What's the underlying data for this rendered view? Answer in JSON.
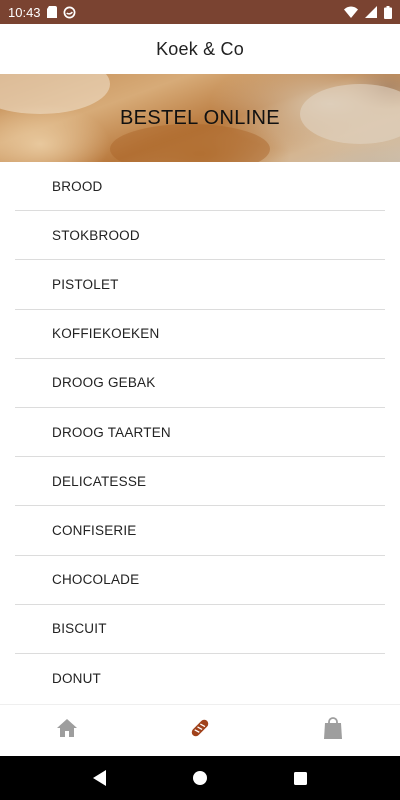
{
  "status_bar": {
    "time": "10:43"
  },
  "app_bar": {
    "title": "Koek & Co"
  },
  "banner": {
    "title": "BESTEL ONLINE"
  },
  "categories": [
    {
      "label": "BROOD"
    },
    {
      "label": "STOKBROOD"
    },
    {
      "label": "PISTOLET"
    },
    {
      "label": "KOFFIEKOEKEN"
    },
    {
      "label": "DROOG GEBAK"
    },
    {
      "label": "DROOG TAARTEN"
    },
    {
      "label": "DELICATESSE"
    },
    {
      "label": "CONFISERIE"
    },
    {
      "label": "CHOCOLADE"
    },
    {
      "label": "BISCUIT"
    },
    {
      "label": "DONUT"
    }
  ],
  "bottom_nav": {
    "items": [
      {
        "icon": "home-icon",
        "active": false
      },
      {
        "icon": "bread-icon",
        "active": true
      },
      {
        "icon": "shopping-bag-icon",
        "active": false
      }
    ],
    "active_color": "#a0421b",
    "inactive_color": "#9e9e9e"
  },
  "colors": {
    "status_bar": "#7a4331"
  }
}
